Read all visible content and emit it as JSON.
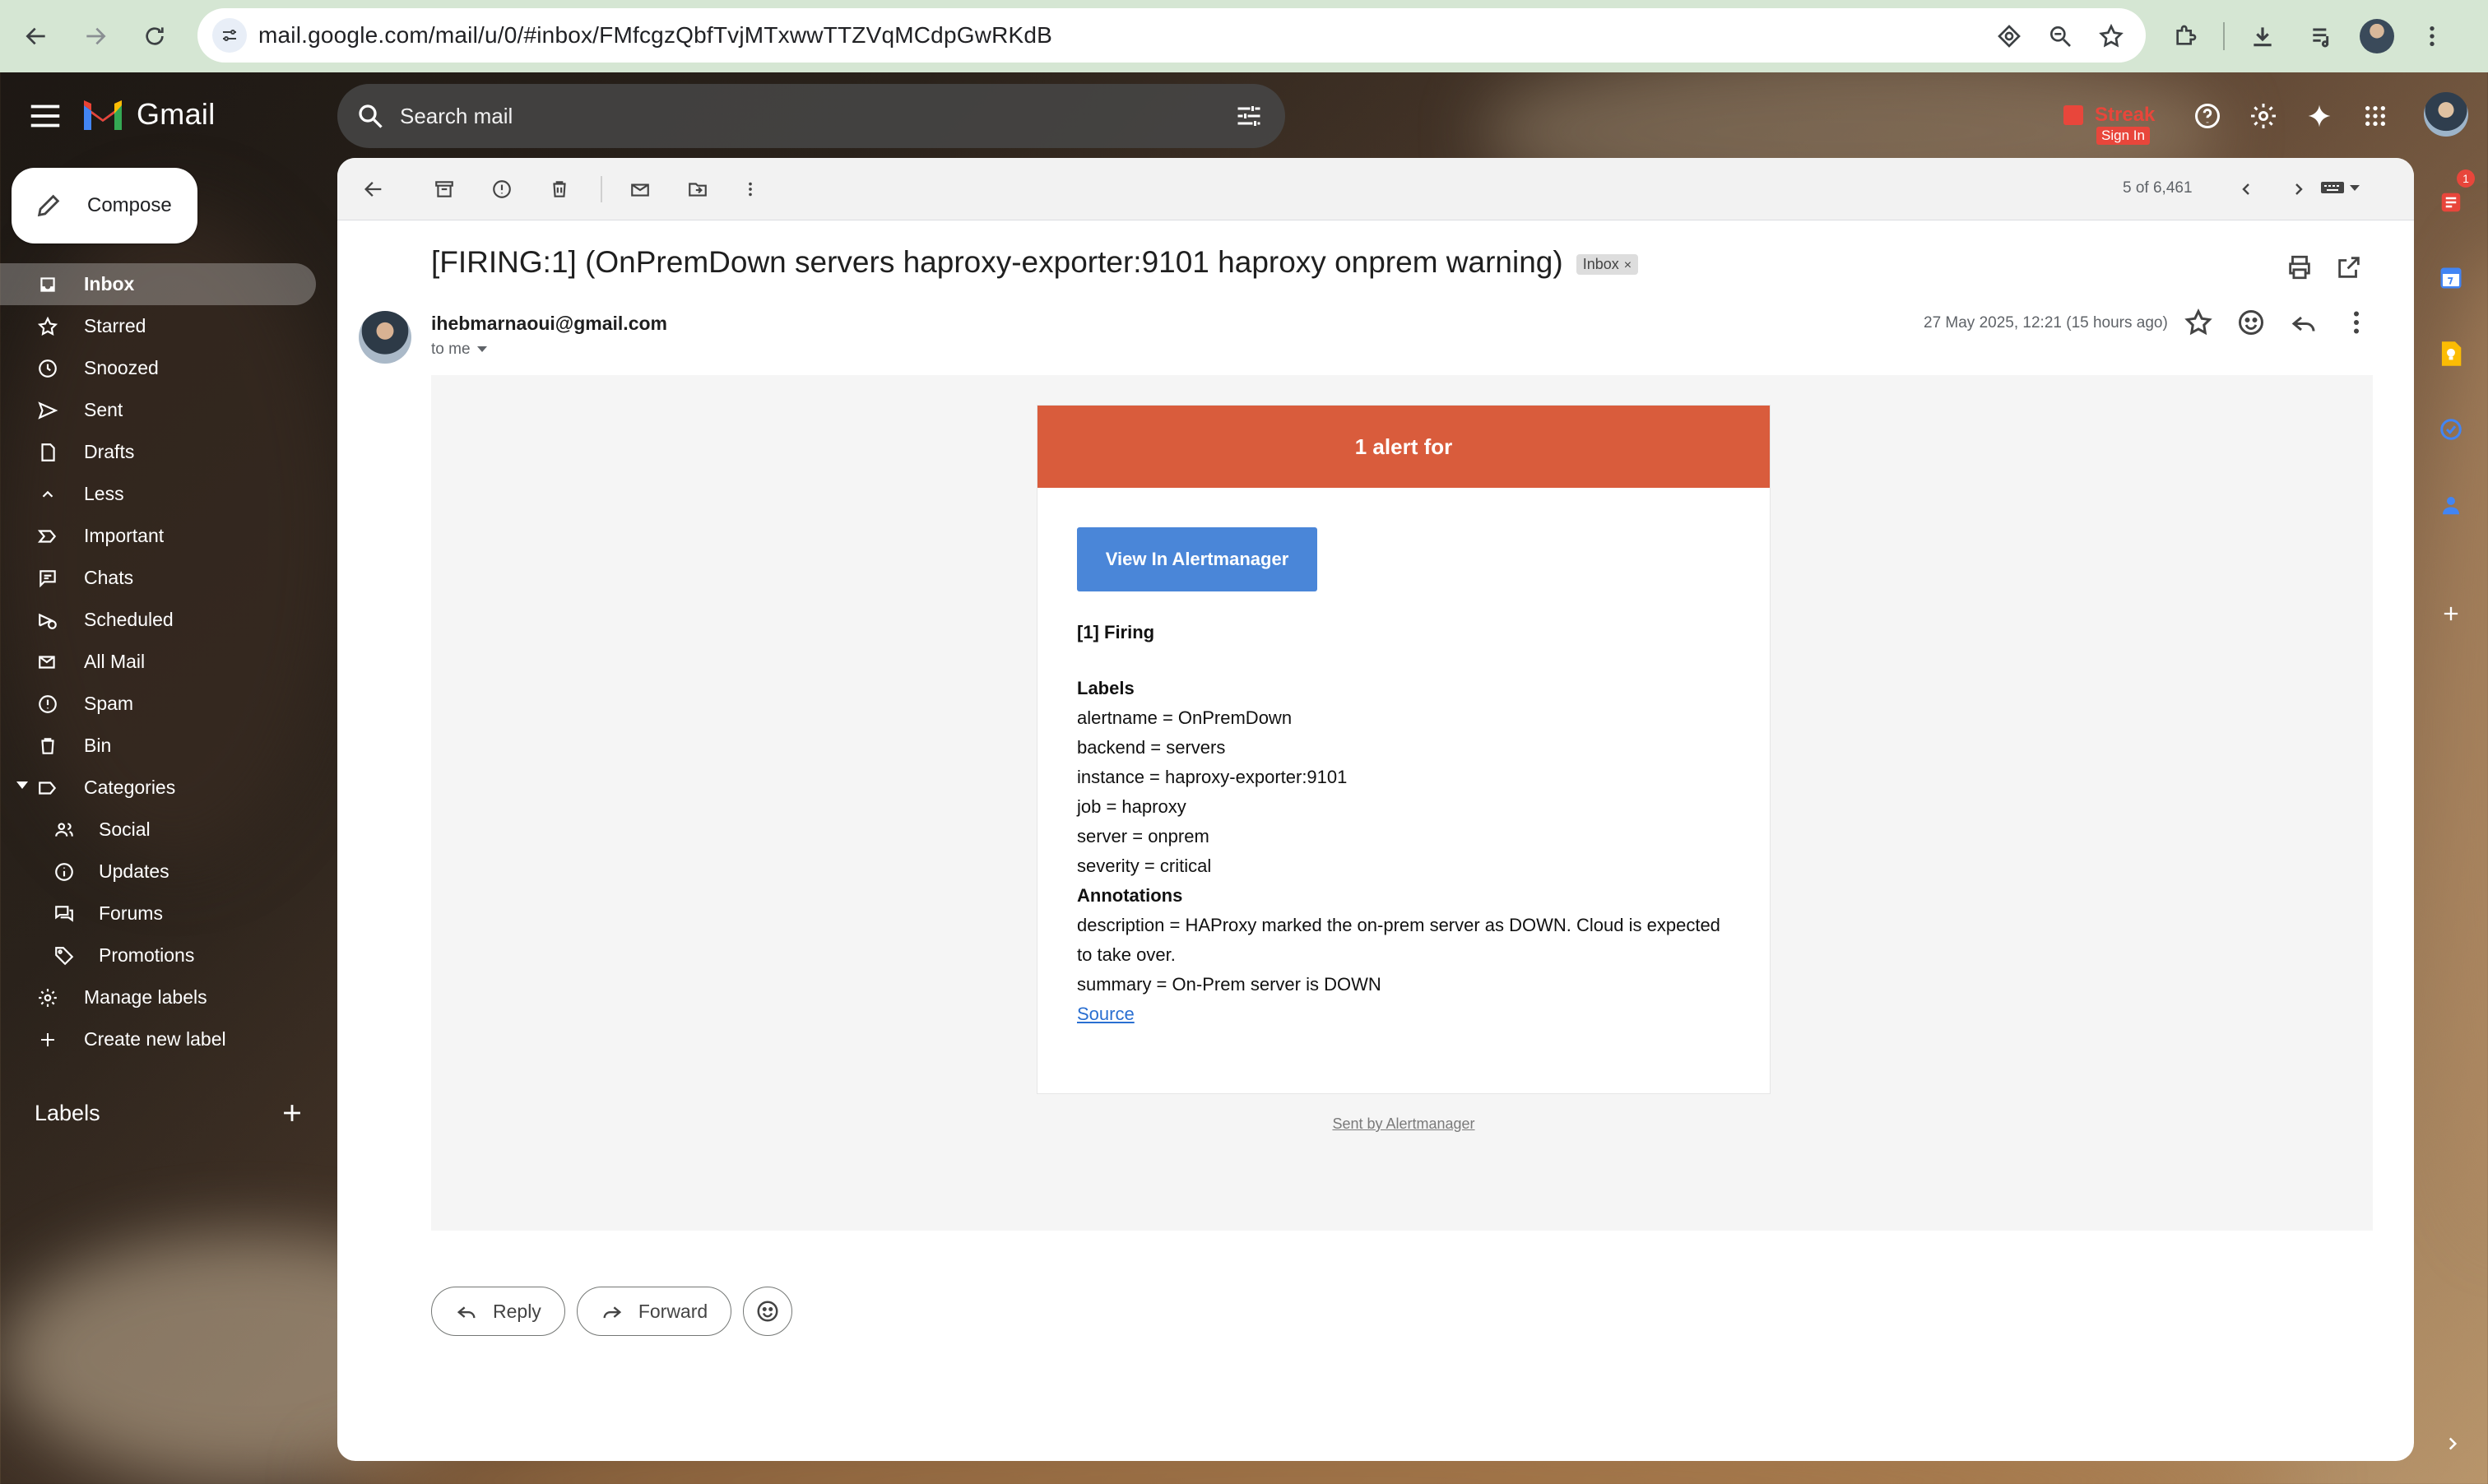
{
  "browser": {
    "url": "mail.google.com/mail/u/0/#inbox/FMfcgzQbfTvjMTxwwTTZVqMCdpGwRKdB"
  },
  "header": {
    "app_name": "Gmail",
    "search_placeholder": "Search mail",
    "streak_label": "Streak",
    "streak_signin": "Sign In"
  },
  "sidebar": {
    "compose_label": "Compose",
    "items": [
      {
        "label": "Inbox",
        "icon": "inbox-icon"
      },
      {
        "label": "Starred",
        "icon": "star-icon"
      },
      {
        "label": "Snoozed",
        "icon": "clock-icon"
      },
      {
        "label": "Sent",
        "icon": "send-icon"
      },
      {
        "label": "Drafts",
        "icon": "draft-icon"
      },
      {
        "label": "Less",
        "icon": "chevron-up-icon"
      },
      {
        "label": "Important",
        "icon": "important-icon"
      },
      {
        "label": "Chats",
        "icon": "chat-icon"
      },
      {
        "label": "Scheduled",
        "icon": "scheduled-icon"
      },
      {
        "label": "All Mail",
        "icon": "all-mail-icon"
      },
      {
        "label": "Spam",
        "icon": "spam-icon"
      },
      {
        "label": "Bin",
        "icon": "trash-icon"
      },
      {
        "label": "Categories",
        "icon": "label-icon"
      },
      {
        "label": "Social",
        "icon": "people-icon"
      },
      {
        "label": "Updates",
        "icon": "info-icon"
      },
      {
        "label": "Forums",
        "icon": "forum-icon"
      },
      {
        "label": "Promotions",
        "icon": "tag-icon"
      },
      {
        "label": "Manage labels",
        "icon": "gear-icon"
      },
      {
        "label": "Create new label",
        "icon": "plus-icon"
      }
    ],
    "labels_heading": "Labels"
  },
  "toolbar": {
    "pager": "5 of 6,461"
  },
  "message": {
    "subject": "[FIRING:1] (OnPremDown servers haproxy-exporter:9101 haproxy onprem warning)",
    "label_chip": "Inbox",
    "label_chip_close": "×",
    "sender": "ihebmarnaoui@gmail.com",
    "to": "to me",
    "date": "27 May 2025, 12:21 (15 hours ago)"
  },
  "email_body": {
    "header": "1 alert for",
    "button": "View In Alertmanager",
    "firing": "[1] Firing",
    "labels_title": "Labels",
    "labels": [
      "alertname = OnPremDown",
      "backend = servers",
      "instance = haproxy-exporter:9101",
      "job = haproxy",
      "server = onprem",
      "severity = critical"
    ],
    "annotations_title": "Annotations",
    "annotations": [
      "description = HAProxy marked the on-prem server as DOWN. Cloud is expected to take over.",
      "summary = On-Prem server is DOWN"
    ],
    "source_link": "Source",
    "footer": "Sent by Alertmanager"
  },
  "actions": {
    "reply": "Reply",
    "forward": "Forward"
  },
  "side_panel": {
    "badge": "1"
  },
  "colors": {
    "alert_header": "#d95c3c",
    "view_button": "#4a86d8",
    "chrome_bar": "#d5e6d3"
  }
}
